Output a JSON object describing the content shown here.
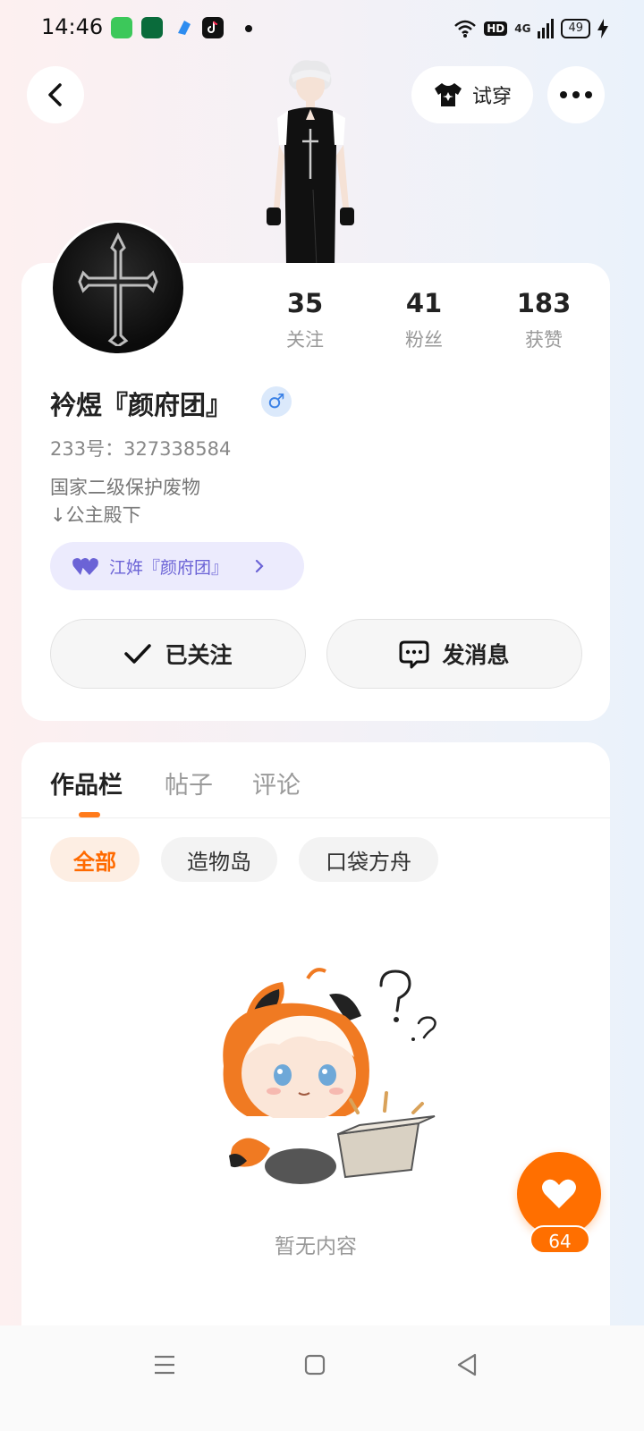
{
  "status_bar": {
    "time": "14:46",
    "app_icons": [
      "app-store-icon",
      "oppo-icon",
      "browser-icon",
      "tiktok-icon"
    ],
    "network": "4G",
    "hd": "HD",
    "battery": "49"
  },
  "header": {
    "back_icon": "chevron-left-icon",
    "try_on_label": "试穿",
    "more_icon": "more-icon"
  },
  "profile": {
    "stats": [
      {
        "value": "35",
        "label": "关注"
      },
      {
        "value": "41",
        "label": "粉丝"
      },
      {
        "value": "183",
        "label": "获赞"
      }
    ],
    "name": "衿煜『颜府团』",
    "gender_symbol": "♂",
    "uid": "233号：327338584",
    "bio_line1": "国家二级保护废物",
    "bio_line2": "↓公主殿下",
    "couple_chip": "江姩『颜府团』",
    "follow_button": "已关注",
    "message_button": "发消息"
  },
  "tabs": [
    {
      "label": "作品栏",
      "active": true
    },
    {
      "label": "帖子",
      "active": false
    },
    {
      "label": "评论",
      "active": false
    }
  ],
  "filters": [
    {
      "label": "全部",
      "active": true
    },
    {
      "label": "造物岛",
      "active": false
    },
    {
      "label": "口袋方舟",
      "active": false
    }
  ],
  "empty_text": "暂无内容",
  "like_count": "64",
  "colors": {
    "accent": "#ff6f00",
    "chip_purple": "#6b63d6",
    "gender_blue": "#3c82e6"
  }
}
